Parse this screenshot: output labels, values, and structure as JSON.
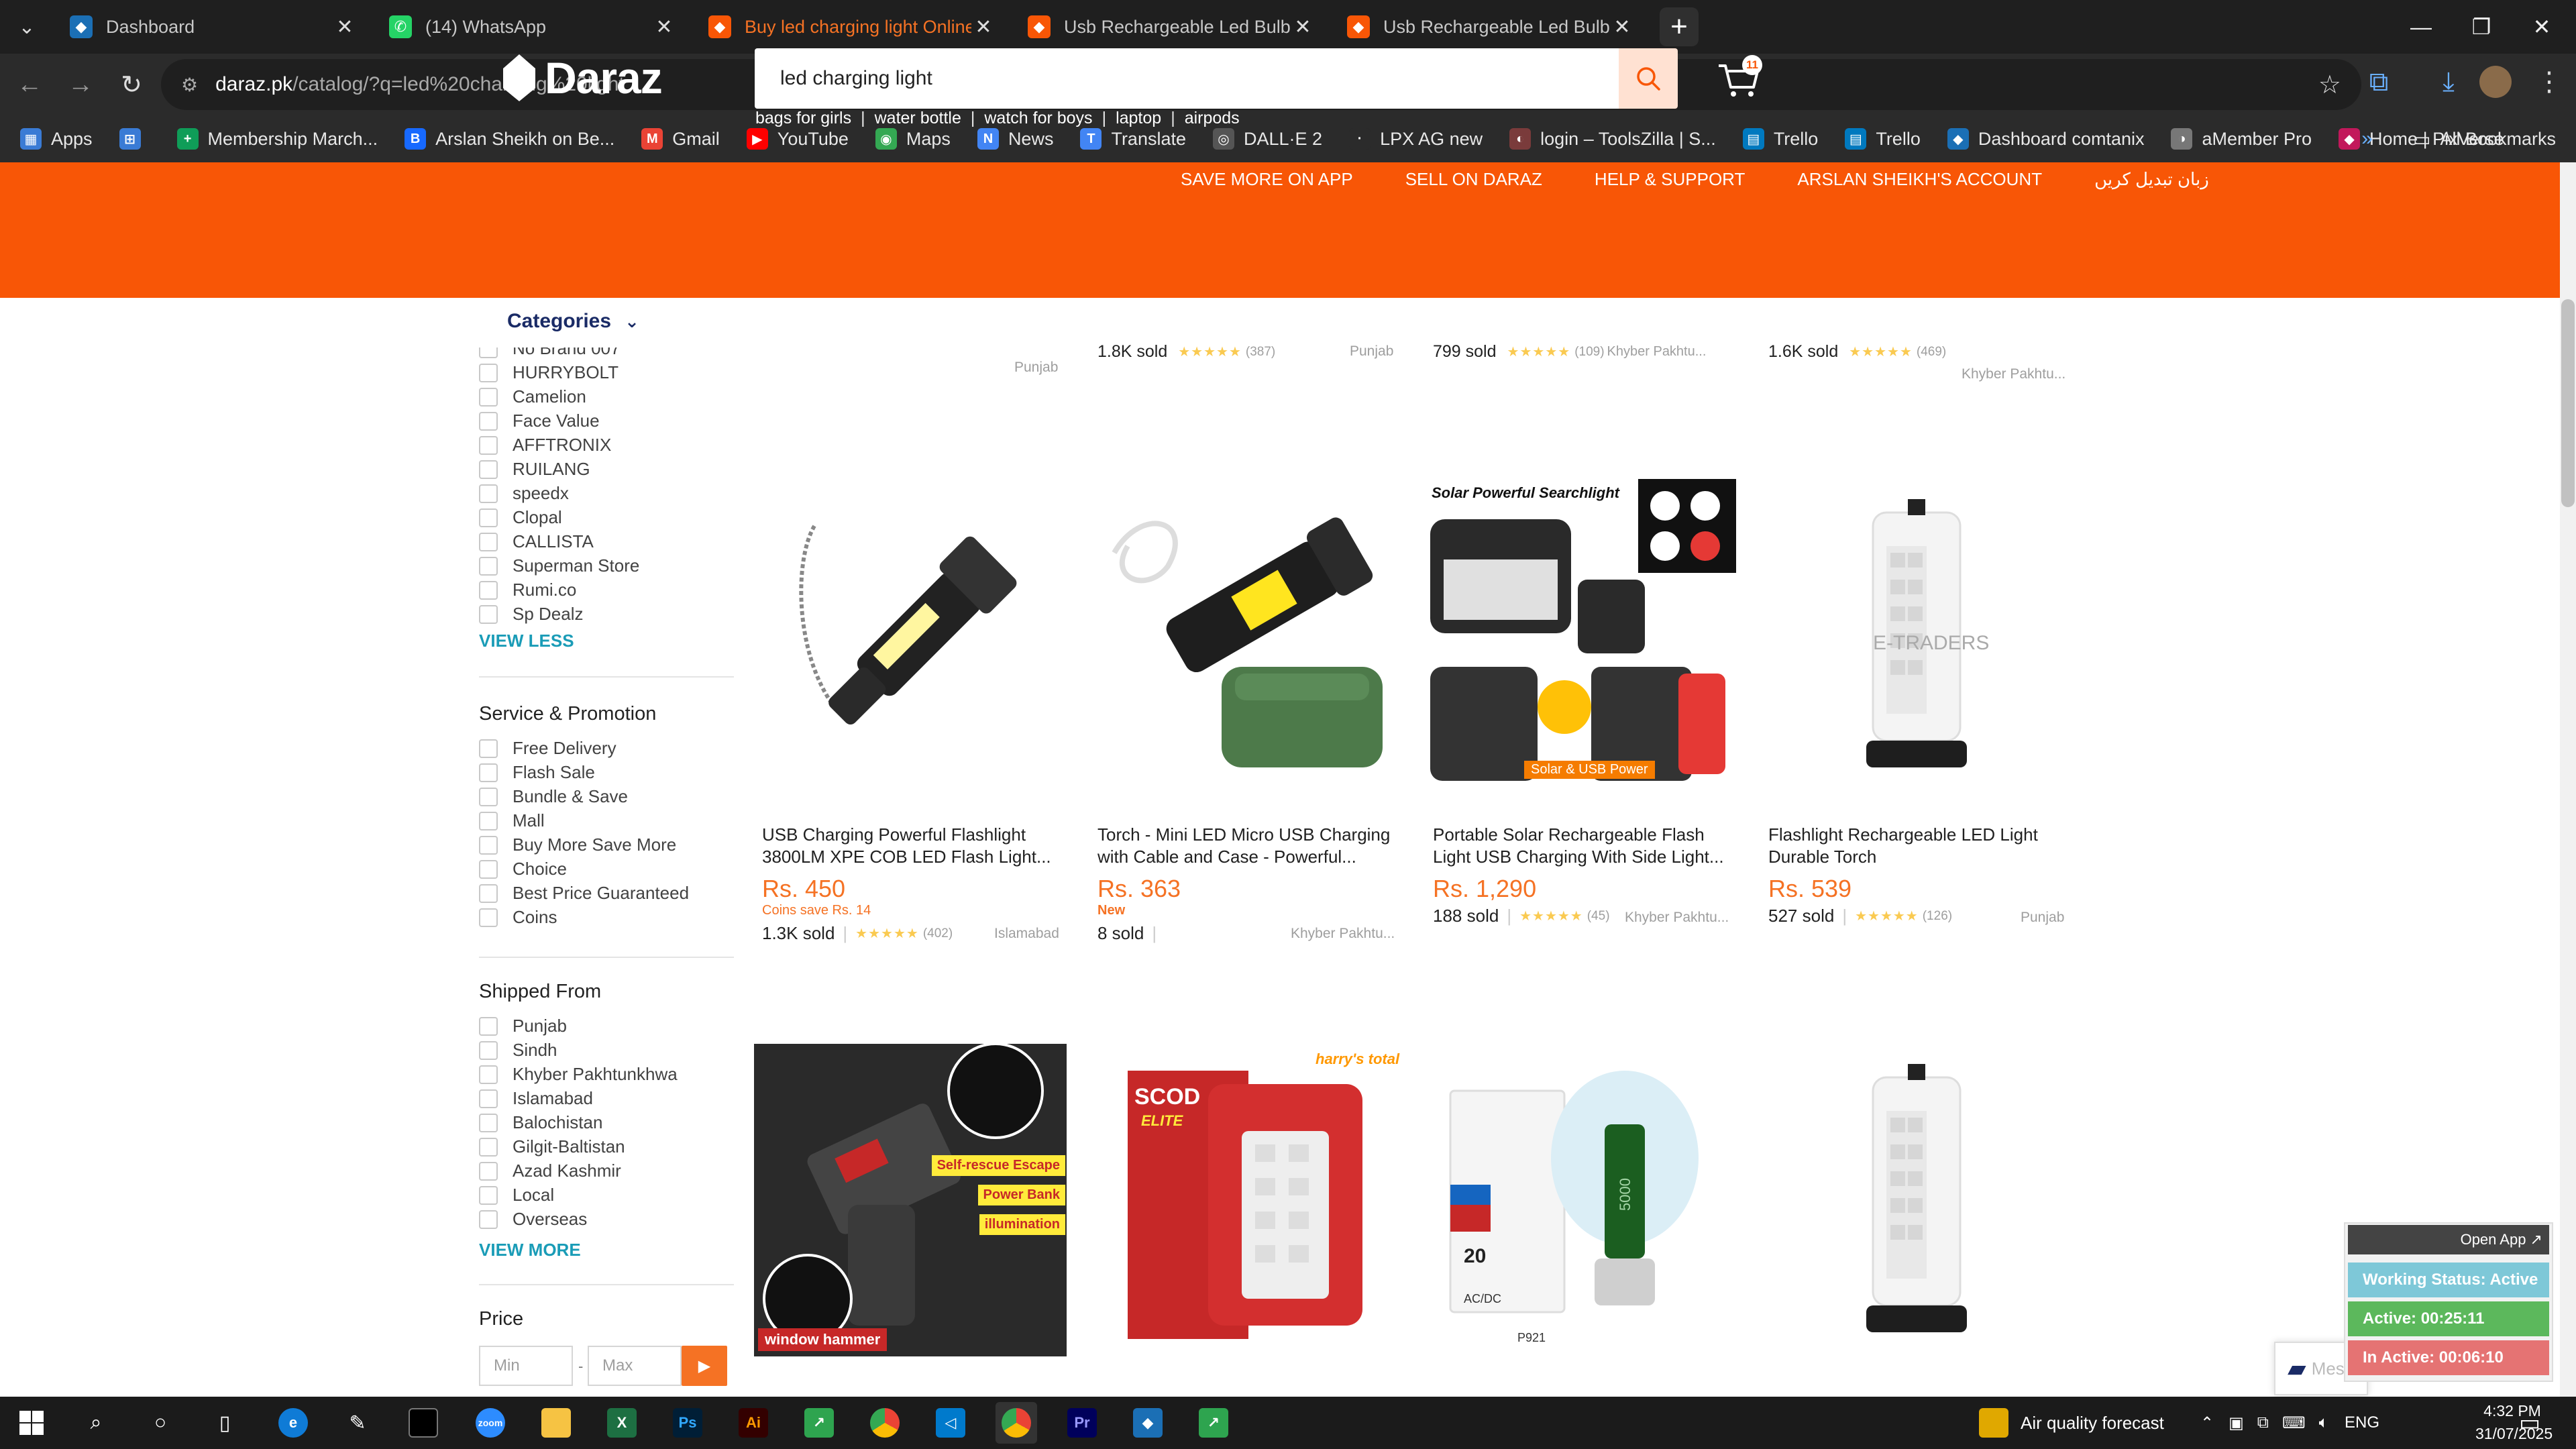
{
  "browser": {
    "tabs": [
      {
        "title": "Dashboard",
        "fav_color": "#1b6fb5",
        "fav": "◆"
      },
      {
        "title": "(14) WhatsApp",
        "fav_color": "#25d366",
        "fav": "✆"
      },
      {
        "title": "Buy led charging light Online at",
        "fav_color": "#f85606",
        "fav": "◆",
        "active": true
      },
      {
        "title": "Usb Rechargeable Led Bulb Por",
        "fav_color": "#f85606",
        "fav": "◆"
      },
      {
        "title": "Usb Rechargeable Led Bulb Por",
        "fav_color": "#f85606",
        "fav": "◆"
      }
    ],
    "url_host": "daraz.pk",
    "url_path": "/catalog/?q=led%20charging%20light",
    "bookmarks": [
      {
        "label": "Apps",
        "color": "#3a7bd5",
        "icon": "▦"
      },
      {
        "label": "",
        "color": "#3a7bd5",
        "icon": "⊞"
      },
      {
        "label": "Membership March...",
        "color": "#0f9d58",
        "icon": "+"
      },
      {
        "label": "Arslan Sheikh on Be...",
        "color": "#1769ff",
        "icon": "B"
      },
      {
        "label": "Gmail",
        "color": "#ea4335",
        "icon": "M"
      },
      {
        "label": "YouTube",
        "color": "#ff0000",
        "icon": "▶"
      },
      {
        "label": "Maps",
        "color": "#34a853",
        "icon": "◉"
      },
      {
        "label": "News",
        "color": "#4285f4",
        "icon": "N"
      },
      {
        "label": "Translate",
        "color": "#4285f4",
        "icon": "T"
      },
      {
        "label": "DALL·E 2",
        "color": "#555555",
        "icon": "◎"
      },
      {
        "label": "LPX AG new",
        "color": "#2b2b2b",
        "icon": "·"
      },
      {
        "label": "login – ToolsZilla | S...",
        "color": "#7a3b3b",
        "icon": "◐"
      },
      {
        "label": "Trello",
        "color": "#0079bf",
        "icon": "▤"
      },
      {
        "label": "Trello",
        "color": "#0079bf",
        "icon": "▤"
      },
      {
        "label": "Dashboard comtanix",
        "color": "#1b6fb5",
        "icon": "◆"
      },
      {
        "label": "aMember Pro",
        "color": "#777777",
        "icon": "◑"
      },
      {
        "label": "Home | PixVerse",
        "color": "#c2185b",
        "icon": "◆"
      }
    ],
    "all_bookmarks": "All Bookmarks"
  },
  "header": {
    "links": [
      "SAVE MORE ON APP",
      "SELL ON DARAZ",
      "HELP & SUPPORT",
      "ARSLAN SHEIKH'S ACCOUNT",
      "زبان تبدیل کریں"
    ],
    "logo": "Daraz",
    "search_value": "led charging light",
    "cart_count": "11",
    "suggestions": [
      "bags for girls",
      "water bottle",
      "watch for boys",
      "laptop",
      "airpods"
    ]
  },
  "sidebar": {
    "categories_label": "Categories",
    "brand_partial": "No Brand 007",
    "brands": [
      "HURRYBOLT",
      "Camelion",
      "Face Value",
      "AFFTRONIX",
      "RUILANG",
      "speedx",
      "Clopal",
      "CALLISTA",
      "Superman Store",
      "Rumi.co",
      "Sp Dealz"
    ],
    "view_less": "VIEW LESS",
    "service_title": "Service & Promotion",
    "service": [
      "Free Delivery",
      "Flash Sale",
      "Bundle & Save",
      "Mall",
      "Buy More Save More",
      "Choice",
      "Best Price Guaranteed",
      "Coins"
    ],
    "shipped_title": "Shipped From",
    "shipped": [
      "Punjab",
      "Sindh",
      "Khyber Pakhtunkhwa",
      "Islamabad",
      "Balochistan",
      "Gilgit-Baltistan",
      "Azad Kashmir",
      "Local",
      "Overseas"
    ],
    "view_more": "VIEW MORE",
    "price_title": "Price",
    "min_placeholder": "Min",
    "max_placeholder": "Max",
    "price_sep": "-"
  },
  "top_row": [
    {
      "sold": "",
      "stars": "",
      "count": "",
      "loc": "Punjab"
    },
    {
      "sold": "1.8K sold",
      "stars": "★★★★★",
      "count": "(387)",
      "loc": "Punjab"
    },
    {
      "sold": "799 sold",
      "stars": "★★★★★",
      "count": "(109)",
      "loc": "Khyber Pakhtu..."
    },
    {
      "sold": "1.6K sold",
      "stars": "★★★★★",
      "count": "(469)",
      "loc": "Khyber Pakhtu..."
    }
  ],
  "products": [
    {
      "title": "USB Charging Powerful Flashlight 3800LM XPE COB LED Flash Light...",
      "price": "Rs. 450",
      "sub": "Coins save Rs. 14",
      "sold": "1.3K sold",
      "stars": "★★★★★",
      "count": "(402)",
      "loc": "Islamabad"
    },
    {
      "title": "Torch - Mini LED Micro USB Charging with Cable and Case - Powerful...",
      "price": "Rs. 363",
      "badge": "New",
      "sold": "8 sold",
      "stars": "",
      "count": "",
      "loc": "Khyber Pakhtu..."
    },
    {
      "title": "Portable Solar Rechargeable Flash Light USB Charging With Side Light...",
      "price": "Rs. 1,290",
      "sold": "188 sold",
      "stars": "★★★★★",
      "count": "(45)",
      "loc": "Khyber Pakhtu...",
      "img_label": "Solar Powerful Searchlight",
      "img_badge": "Solar & USB Power"
    },
    {
      "title": "Flashlight Rechargeable LED Light Durable Torch",
      "price": "Rs. 539",
      "sold": "527 sold",
      "stars": "★★★★★",
      "count": "(126)",
      "loc": "Punjab",
      "img_label": "E-TRADERS"
    }
  ],
  "row3_images": [
    {
      "labels": [
        "Self-rescue Escape",
        "Power Bank",
        "illumination",
        "window hammer"
      ]
    },
    {
      "labels": [
        "SCOD",
        "ELITE",
        "harry's total"
      ]
    },
    {
      "labels": [
        "20",
        "AC/DC",
        "P921",
        "5000"
      ]
    },
    {
      "labels": []
    }
  ],
  "widgets": {
    "open_app": "Open App ↗",
    "working": "Working Status: Active",
    "active": "Active: 00:25:11",
    "inactive": "In Active: 00:06:10",
    "chat": "Messages"
  },
  "taskbar": {
    "weather": "Air quality forecast",
    "lang": "ENG",
    "time": "4:32 PM",
    "date": "31/07/2025"
  }
}
